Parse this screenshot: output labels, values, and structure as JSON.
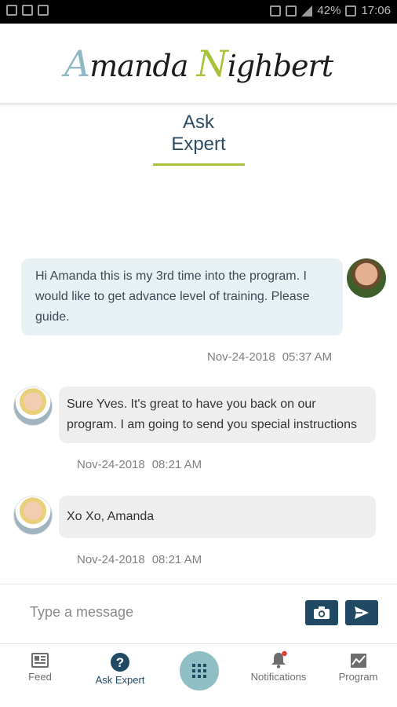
{
  "status_bar": {
    "battery": "42%",
    "time": "17:06"
  },
  "header": {
    "logo_first": "manda",
    "logo_second": "ighbert",
    "logo_initial_a": "A",
    "logo_initial_n": "N"
  },
  "page": {
    "title": "Ask Expert"
  },
  "messages": [
    {
      "sender": "user",
      "text": "Hi Amanda this is my 3rd time into the program. I would like to get advance level of training. Please guide.",
      "date": "Nov-24-2018",
      "time": "05:37 AM"
    },
    {
      "sender": "expert",
      "text": "Sure Yves. It's great to have you back on our program. I am going to send you special instructions",
      "date": "Nov-24-2018",
      "time": "08:21 AM"
    },
    {
      "sender": "expert",
      "text": "Xo Xo, Amanda",
      "date": "Nov-24-2018",
      "time": "08:21 AM"
    }
  ],
  "composer": {
    "placeholder": "Type a message"
  },
  "nav": {
    "feed": "Feed",
    "ask_expert": "Ask Expert",
    "notifications": "Notifications",
    "program": "Program"
  },
  "colors": {
    "primary": "#204a63",
    "accent_green": "#a8c23a",
    "accent_teal": "#8fbfc4",
    "notification_dot": "#e53935"
  }
}
